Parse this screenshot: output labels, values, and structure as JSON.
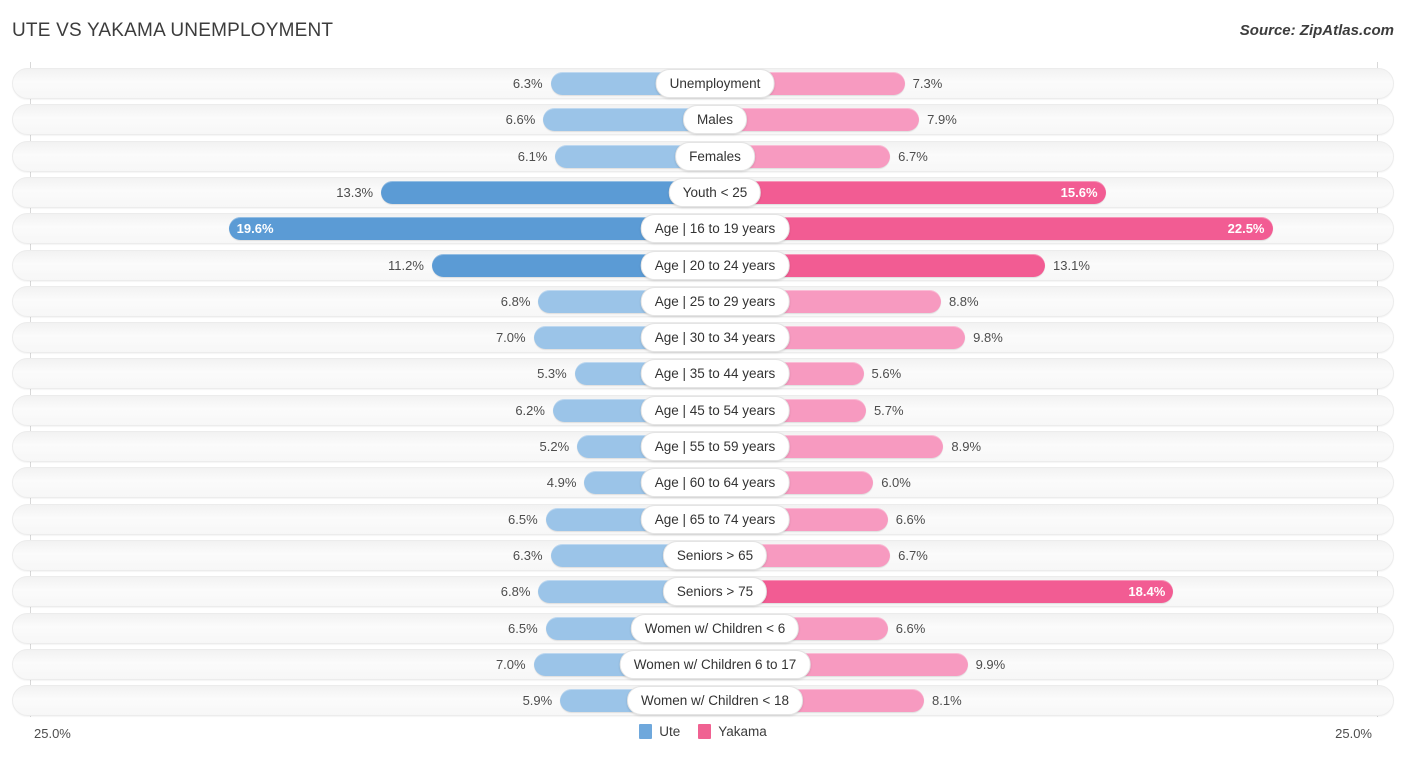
{
  "header": {
    "title": "UTE VS YAKAMA UNEMPLOYMENT",
    "source": "Source: ZipAtlas.com"
  },
  "axis": {
    "min_label": "25.0%",
    "max_label": "25.0%",
    "max_value": 25.0
  },
  "legend": {
    "items": [
      {
        "label": "Ute",
        "color": "#6FA8DC"
      },
      {
        "label": "Yakama",
        "color": "#F06292"
      }
    ]
  },
  "colors": {
    "left_light": "#9BC4E8",
    "left_dark": "#5B9BD5",
    "right_light": "#F79AC0",
    "right_dark": "#F25C93",
    "track": "#F7F7F7",
    "gridline": "#D8D8D8",
    "text": "#4D4D4D"
  },
  "chart_data": {
    "type": "bar",
    "subtype": "diverging-bidirectional",
    "title": "UTE VS YAKAMA UNEMPLOYMENT",
    "xlabel": "",
    "ylabel": "",
    "xlim": [
      25.0,
      25.0
    ],
    "grid": true,
    "legend_position": "bottom-center",
    "categories": [
      "Unemployment",
      "Males",
      "Females",
      "Youth < 25",
      "Age | 16 to 19 years",
      "Age | 20 to 24 years",
      "Age | 25 to 29 years",
      "Age | 30 to 34 years",
      "Age | 35 to 44 years",
      "Age | 45 to 54 years",
      "Age | 55 to 59 years",
      "Age | 60 to 64 years",
      "Age | 65 to 74 years",
      "Seniors > 65",
      "Seniors > 75",
      "Women w/ Children < 6",
      "Women w/ Children 6 to 17",
      "Women w/ Children < 18"
    ],
    "series": [
      {
        "name": "Ute",
        "side": "left",
        "color": "#9BC4E8",
        "values": [
          6.3,
          6.6,
          6.1,
          13.3,
          19.6,
          11.2,
          6.8,
          7.0,
          5.3,
          6.2,
          5.2,
          4.9,
          6.5,
          6.3,
          6.8,
          6.5,
          7.0,
          5.9
        ]
      },
      {
        "name": "Yakama",
        "side": "right",
        "color": "#F79AC0",
        "values": [
          7.3,
          7.9,
          6.7,
          15.6,
          22.5,
          13.1,
          8.8,
          9.8,
          5.6,
          5.7,
          8.9,
          6.0,
          6.6,
          6.7,
          18.4,
          6.6,
          9.9,
          8.1
        ]
      }
    ]
  },
  "rows": [
    {
      "label": "Unemployment",
      "left": "6.3%",
      "right": "7.3%",
      "left_val": 6.3,
      "right_val": 7.3,
      "left_emph": false,
      "right_emph": false
    },
    {
      "label": "Males",
      "left": "6.6%",
      "right": "7.9%",
      "left_val": 6.6,
      "right_val": 7.9,
      "left_emph": false,
      "right_emph": false
    },
    {
      "label": "Females",
      "left": "6.1%",
      "right": "6.7%",
      "left_val": 6.1,
      "right_val": 6.7,
      "left_emph": false,
      "right_emph": false
    },
    {
      "label": "Youth < 25",
      "left": "13.3%",
      "right": "15.6%",
      "left_val": 13.3,
      "right_val": 15.6,
      "left_emph": true,
      "right_emph": true
    },
    {
      "label": "Age | 16 to 19 years",
      "left": "19.6%",
      "right": "22.5%",
      "left_val": 19.6,
      "right_val": 22.5,
      "left_emph": true,
      "right_emph": true
    },
    {
      "label": "Age | 20 to 24 years",
      "left": "11.2%",
      "right": "13.1%",
      "left_val": 11.2,
      "right_val": 13.1,
      "left_emph": true,
      "right_emph": true
    },
    {
      "label": "Age | 25 to 29 years",
      "left": "6.8%",
      "right": "8.8%",
      "left_val": 6.8,
      "right_val": 8.8,
      "left_emph": false,
      "right_emph": false
    },
    {
      "label": "Age | 30 to 34 years",
      "left": "7.0%",
      "right": "9.8%",
      "left_val": 7.0,
      "right_val": 9.8,
      "left_emph": false,
      "right_emph": false
    },
    {
      "label": "Age | 35 to 44 years",
      "left": "5.3%",
      "right": "5.6%",
      "left_val": 5.3,
      "right_val": 5.6,
      "left_emph": false,
      "right_emph": false
    },
    {
      "label": "Age | 45 to 54 years",
      "left": "6.2%",
      "right": "5.7%",
      "left_val": 6.2,
      "right_val": 5.7,
      "left_emph": false,
      "right_emph": false
    },
    {
      "label": "Age | 55 to 59 years",
      "left": "5.2%",
      "right": "8.9%",
      "left_val": 5.2,
      "right_val": 8.9,
      "left_emph": false,
      "right_emph": false
    },
    {
      "label": "Age | 60 to 64 years",
      "left": "4.9%",
      "right": "6.0%",
      "left_val": 4.9,
      "right_val": 6.0,
      "left_emph": false,
      "right_emph": false
    },
    {
      "label": "Age | 65 to 74 years",
      "left": "6.5%",
      "right": "6.6%",
      "left_val": 6.5,
      "right_val": 6.6,
      "left_emph": false,
      "right_emph": false
    },
    {
      "label": "Seniors > 65",
      "left": "6.3%",
      "right": "6.7%",
      "left_val": 6.3,
      "right_val": 6.7,
      "left_emph": false,
      "right_emph": false
    },
    {
      "label": "Seniors > 75",
      "left": "6.8%",
      "right": "18.4%",
      "left_val": 6.8,
      "right_val": 18.4,
      "left_emph": false,
      "right_emph": true
    },
    {
      "label": "Women w/ Children < 6",
      "left": "6.5%",
      "right": "6.6%",
      "left_val": 6.5,
      "right_val": 6.6,
      "left_emph": false,
      "right_emph": false
    },
    {
      "label": "Women w/ Children 6 to 17",
      "left": "7.0%",
      "right": "9.9%",
      "left_val": 7.0,
      "right_val": 9.9,
      "left_emph": false,
      "right_emph": false
    },
    {
      "label": "Women w/ Children < 18",
      "left": "5.9%",
      "right": "8.1%",
      "left_val": 5.9,
      "right_val": 8.1,
      "left_emph": false,
      "right_emph": false
    }
  ]
}
